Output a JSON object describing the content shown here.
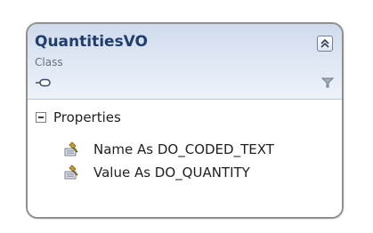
{
  "class_shape": {
    "name": "QuantitiesVO",
    "kind": "Class",
    "icons": {
      "collapse": "double-chevron-up-icon",
      "inheritance": "link-icon",
      "filter": "filter-icon"
    },
    "colors": {
      "header_gradient_top": "#cfdaec",
      "header_gradient_bottom": "#eef3f9",
      "name_text": "#1f3e6d",
      "border": "#8f8f8f"
    }
  },
  "compartment": {
    "label": "Properties",
    "expander_state": "expanded",
    "items": [
      {
        "text": "Name As DO_CODED_TEXT",
        "icon": "property-icon"
      },
      {
        "text": "Value As DO_QUANTITY",
        "icon": "property-icon"
      }
    ]
  }
}
